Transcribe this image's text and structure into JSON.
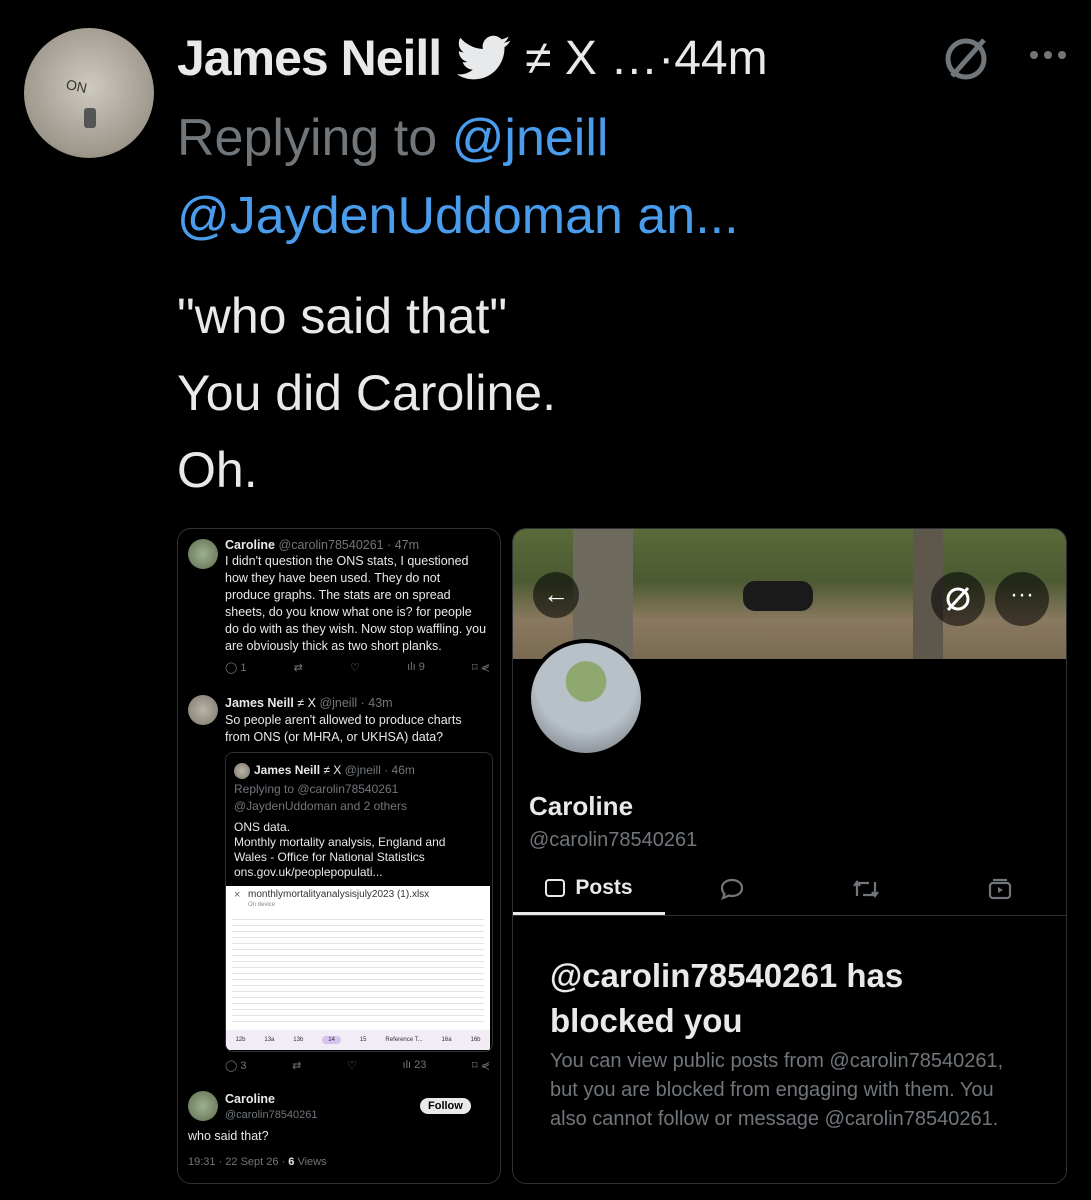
{
  "tweet": {
    "author": "James Neill",
    "suffix_text": "≠ X …·44m",
    "reply_prefix": "Replying to ",
    "reply_handle1": "@jneill",
    "reply_handle2": "@JaydenUddoman an...",
    "text_lines": [
      "\"who said that\"",
      "You did Caroline.",
      "Oh."
    ]
  },
  "left_shot": {
    "t1": {
      "name": "Caroline",
      "handle_time": "@carolin78540261 · 47m",
      "text": "I didn't question the ONS stats, I questioned how they have been used. They do not produce graphs. The stats are on spread sheets, do you know what one is? for people do do with as they wish. Now stop waffling. you are obviously thick as two short planks.",
      "replies": "1",
      "views": "9"
    },
    "t2": {
      "name": "James Neill",
      "suffix": "≠ X",
      "handle_time": "@jneill · 43m",
      "text": "So people aren't allowed to produce charts from ONS (or MHRA, or UKHSA) data?",
      "replies": "3",
      "views": "23"
    },
    "quote": {
      "name": "James Neill",
      "suffix": "≠ X",
      "handle_time": "@jneill · 46m",
      "replying": "Replying to @carolin78540261",
      "replying2": "@JaydenUddoman and 2 others",
      "text_lines": [
        "ONS data.",
        "Monthly mortality analysis, England and",
        "Wales - Office for National Statistics",
        "ons.gov.uk/peoplepopulati..."
      ],
      "sheet_title": "monthlymortalityanalysisjuly2023 (1).xlsx",
      "sheet_sub": "On device",
      "sheet_tabs": [
        "12b",
        "13a",
        "13b",
        "14",
        "15",
        "Reference T...",
        "16a",
        "16b"
      ]
    },
    "t3": {
      "name": "Caroline",
      "handle": "@carolin78540261",
      "follow": "Follow",
      "text": "who said that?",
      "meta": "19:31 · 22 Sept 26 · ",
      "views_count": "6",
      "views_label": " Views"
    }
  },
  "right_shot": {
    "name": "Caroline",
    "handle": "@carolin78540261",
    "tabs": [
      "Posts"
    ],
    "blocked_title": "@carolin78540261 has blocked you",
    "blocked_body": "You can view public posts from @carolin78540261, but you are blocked from engaging with them. You also cannot follow or message @carolin78540261."
  },
  "colors": {
    "accent": "#4a9ded",
    "gray": "#71767b",
    "bg": "#000000"
  }
}
